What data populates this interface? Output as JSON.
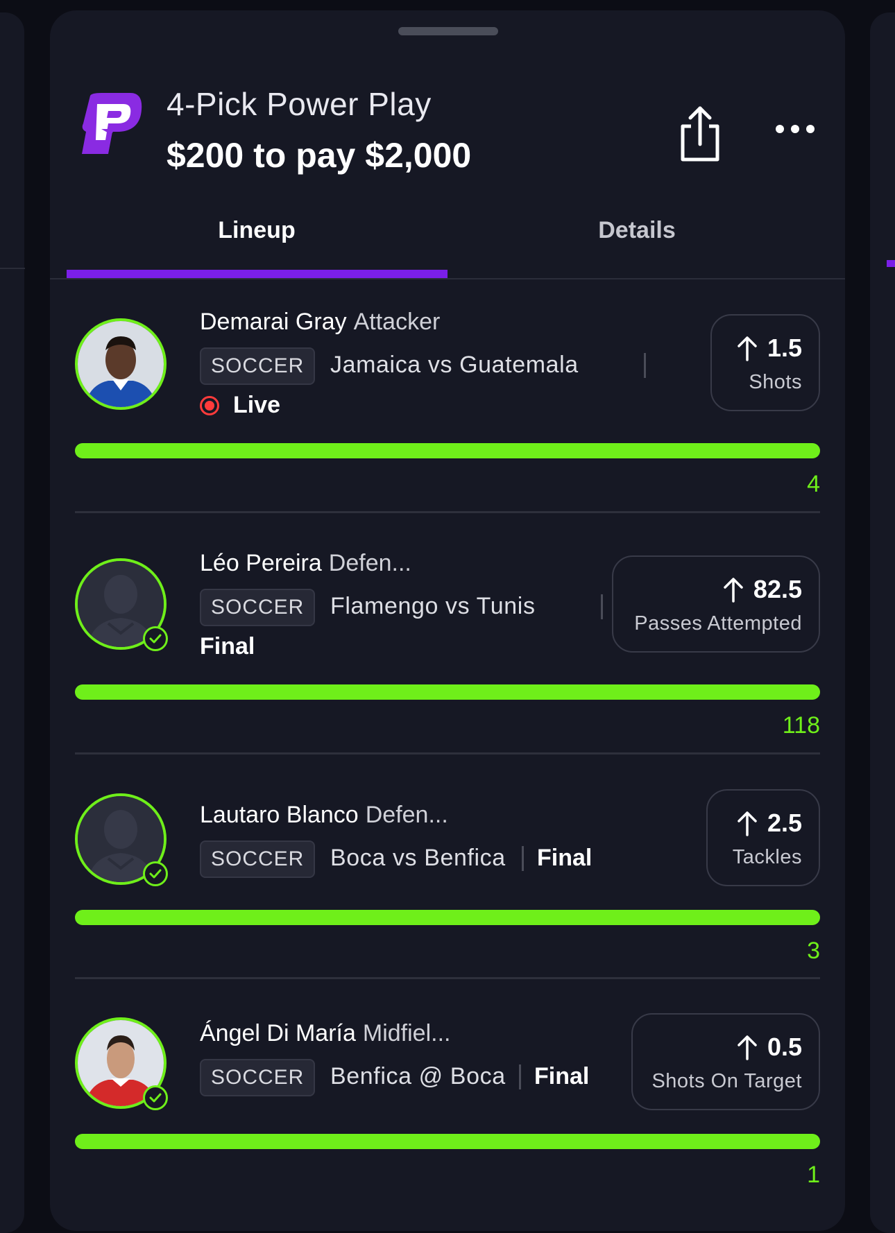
{
  "header": {
    "title": "4-Pick Power Play",
    "subtitle": "$200 to pay $2,000",
    "logo_icon": "prizepicks-logo",
    "share_icon": "share-icon",
    "more_icon": "more-options-icon"
  },
  "tabs": [
    {
      "label": "Lineup",
      "active": true
    },
    {
      "label": "Details",
      "active": false
    }
  ],
  "picks": [
    {
      "name": "Demarai Gray",
      "position": "Attacker",
      "sport": "SOCCER",
      "matchup": "Jamaica vs Guatemala",
      "status": "Live",
      "line": "1.5",
      "stat": "Shots",
      "direction": "up",
      "actual": "4",
      "progress": 1.0
    },
    {
      "name": "Léo Pereira",
      "position": "Defen...",
      "sport": "SOCCER",
      "matchup": "Flamengo vs Tunis",
      "status": "Final",
      "line": "82.5",
      "stat": "Passes Attempted",
      "direction": "up",
      "actual": "118",
      "progress": 1.0
    },
    {
      "name": "Lautaro Blanco",
      "position": "Defen...",
      "sport": "SOCCER",
      "matchup": "Boca vs Benfica",
      "status": "Final",
      "line": "2.5",
      "stat": "Tackles",
      "direction": "up",
      "actual": "3",
      "progress": 1.0
    },
    {
      "name": "Ángel Di María",
      "position": "Midfiel...",
      "sport": "SOCCER",
      "matchup": "Benfica @ Boca",
      "status": "Final",
      "line": "0.5",
      "stat": "Shots On Target",
      "direction": "up",
      "actual": "1",
      "progress": 1.0
    }
  ],
  "colors": {
    "accent_purple": "#7b1fe8",
    "progress_green": "#6fef1a",
    "live_red": "#ff3b3b",
    "sheet_bg": "#161824"
  }
}
